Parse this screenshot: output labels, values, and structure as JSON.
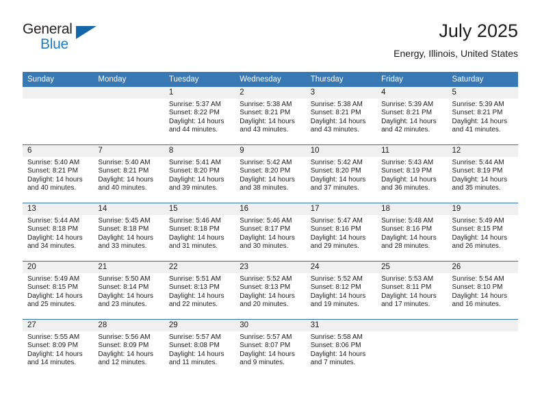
{
  "brand": {
    "name_top": "General",
    "name_bottom": "Blue",
    "triangle_color": "#1566a8",
    "blue": "#1e7bc4"
  },
  "header": {
    "title": "July 2025",
    "subtitle": "Energy, Illinois, United States"
  },
  "theme": {
    "header_bar": "#3878b4",
    "row_divider": "#2f6fad",
    "daynum_band": "#f0f0f0"
  },
  "weekday_headers": [
    "Sunday",
    "Monday",
    "Tuesday",
    "Wednesday",
    "Thursday",
    "Friday",
    "Saturday"
  ],
  "weeks": [
    [
      {
        "day": "",
        "sunrise": "",
        "sunset": "",
        "daylight1": "",
        "daylight2": ""
      },
      {
        "day": "",
        "sunrise": "",
        "sunset": "",
        "daylight1": "",
        "daylight2": ""
      },
      {
        "day": "1",
        "sunrise": "Sunrise: 5:37 AM",
        "sunset": "Sunset: 8:22 PM",
        "daylight1": "Daylight: 14 hours",
        "daylight2": "and 44 minutes."
      },
      {
        "day": "2",
        "sunrise": "Sunrise: 5:38 AM",
        "sunset": "Sunset: 8:21 PM",
        "daylight1": "Daylight: 14 hours",
        "daylight2": "and 43 minutes."
      },
      {
        "day": "3",
        "sunrise": "Sunrise: 5:38 AM",
        "sunset": "Sunset: 8:21 PM",
        "daylight1": "Daylight: 14 hours",
        "daylight2": "and 43 minutes."
      },
      {
        "day": "4",
        "sunrise": "Sunrise: 5:39 AM",
        "sunset": "Sunset: 8:21 PM",
        "daylight1": "Daylight: 14 hours",
        "daylight2": "and 42 minutes."
      },
      {
        "day": "5",
        "sunrise": "Sunrise: 5:39 AM",
        "sunset": "Sunset: 8:21 PM",
        "daylight1": "Daylight: 14 hours",
        "daylight2": "and 41 minutes."
      }
    ],
    [
      {
        "day": "6",
        "sunrise": "Sunrise: 5:40 AM",
        "sunset": "Sunset: 8:21 PM",
        "daylight1": "Daylight: 14 hours",
        "daylight2": "and 40 minutes."
      },
      {
        "day": "7",
        "sunrise": "Sunrise: 5:40 AM",
        "sunset": "Sunset: 8:21 PM",
        "daylight1": "Daylight: 14 hours",
        "daylight2": "and 40 minutes."
      },
      {
        "day": "8",
        "sunrise": "Sunrise: 5:41 AM",
        "sunset": "Sunset: 8:20 PM",
        "daylight1": "Daylight: 14 hours",
        "daylight2": "and 39 minutes."
      },
      {
        "day": "9",
        "sunrise": "Sunrise: 5:42 AM",
        "sunset": "Sunset: 8:20 PM",
        "daylight1": "Daylight: 14 hours",
        "daylight2": "and 38 minutes."
      },
      {
        "day": "10",
        "sunrise": "Sunrise: 5:42 AM",
        "sunset": "Sunset: 8:20 PM",
        "daylight1": "Daylight: 14 hours",
        "daylight2": "and 37 minutes."
      },
      {
        "day": "11",
        "sunrise": "Sunrise: 5:43 AM",
        "sunset": "Sunset: 8:19 PM",
        "daylight1": "Daylight: 14 hours",
        "daylight2": "and 36 minutes."
      },
      {
        "day": "12",
        "sunrise": "Sunrise: 5:44 AM",
        "sunset": "Sunset: 8:19 PM",
        "daylight1": "Daylight: 14 hours",
        "daylight2": "and 35 minutes."
      }
    ],
    [
      {
        "day": "13",
        "sunrise": "Sunrise: 5:44 AM",
        "sunset": "Sunset: 8:18 PM",
        "daylight1": "Daylight: 14 hours",
        "daylight2": "and 34 minutes."
      },
      {
        "day": "14",
        "sunrise": "Sunrise: 5:45 AM",
        "sunset": "Sunset: 8:18 PM",
        "daylight1": "Daylight: 14 hours",
        "daylight2": "and 33 minutes."
      },
      {
        "day": "15",
        "sunrise": "Sunrise: 5:46 AM",
        "sunset": "Sunset: 8:18 PM",
        "daylight1": "Daylight: 14 hours",
        "daylight2": "and 31 minutes."
      },
      {
        "day": "16",
        "sunrise": "Sunrise: 5:46 AM",
        "sunset": "Sunset: 8:17 PM",
        "daylight1": "Daylight: 14 hours",
        "daylight2": "and 30 minutes."
      },
      {
        "day": "17",
        "sunrise": "Sunrise: 5:47 AM",
        "sunset": "Sunset: 8:16 PM",
        "daylight1": "Daylight: 14 hours",
        "daylight2": "and 29 minutes."
      },
      {
        "day": "18",
        "sunrise": "Sunrise: 5:48 AM",
        "sunset": "Sunset: 8:16 PM",
        "daylight1": "Daylight: 14 hours",
        "daylight2": "and 28 minutes."
      },
      {
        "day": "19",
        "sunrise": "Sunrise: 5:49 AM",
        "sunset": "Sunset: 8:15 PM",
        "daylight1": "Daylight: 14 hours",
        "daylight2": "and 26 minutes."
      }
    ],
    [
      {
        "day": "20",
        "sunrise": "Sunrise: 5:49 AM",
        "sunset": "Sunset: 8:15 PM",
        "daylight1": "Daylight: 14 hours",
        "daylight2": "and 25 minutes."
      },
      {
        "day": "21",
        "sunrise": "Sunrise: 5:50 AM",
        "sunset": "Sunset: 8:14 PM",
        "daylight1": "Daylight: 14 hours",
        "daylight2": "and 23 minutes."
      },
      {
        "day": "22",
        "sunrise": "Sunrise: 5:51 AM",
        "sunset": "Sunset: 8:13 PM",
        "daylight1": "Daylight: 14 hours",
        "daylight2": "and 22 minutes."
      },
      {
        "day": "23",
        "sunrise": "Sunrise: 5:52 AM",
        "sunset": "Sunset: 8:13 PM",
        "daylight1": "Daylight: 14 hours",
        "daylight2": "and 20 minutes."
      },
      {
        "day": "24",
        "sunrise": "Sunrise: 5:52 AM",
        "sunset": "Sunset: 8:12 PM",
        "daylight1": "Daylight: 14 hours",
        "daylight2": "and 19 minutes."
      },
      {
        "day": "25",
        "sunrise": "Sunrise: 5:53 AM",
        "sunset": "Sunset: 8:11 PM",
        "daylight1": "Daylight: 14 hours",
        "daylight2": "and 17 minutes."
      },
      {
        "day": "26",
        "sunrise": "Sunrise: 5:54 AM",
        "sunset": "Sunset: 8:10 PM",
        "daylight1": "Daylight: 14 hours",
        "daylight2": "and 16 minutes."
      }
    ],
    [
      {
        "day": "27",
        "sunrise": "Sunrise: 5:55 AM",
        "sunset": "Sunset: 8:09 PM",
        "daylight1": "Daylight: 14 hours",
        "daylight2": "and 14 minutes."
      },
      {
        "day": "28",
        "sunrise": "Sunrise: 5:56 AM",
        "sunset": "Sunset: 8:09 PM",
        "daylight1": "Daylight: 14 hours",
        "daylight2": "and 12 minutes."
      },
      {
        "day": "29",
        "sunrise": "Sunrise: 5:57 AM",
        "sunset": "Sunset: 8:08 PM",
        "daylight1": "Daylight: 14 hours",
        "daylight2": "and 11 minutes."
      },
      {
        "day": "30",
        "sunrise": "Sunrise: 5:57 AM",
        "sunset": "Sunset: 8:07 PM",
        "daylight1": "Daylight: 14 hours",
        "daylight2": "and 9 minutes."
      },
      {
        "day": "31",
        "sunrise": "Sunrise: 5:58 AM",
        "sunset": "Sunset: 8:06 PM",
        "daylight1": "Daylight: 14 hours",
        "daylight2": "and 7 minutes."
      },
      {
        "day": "",
        "sunrise": "",
        "sunset": "",
        "daylight1": "",
        "daylight2": ""
      },
      {
        "day": "",
        "sunrise": "",
        "sunset": "",
        "daylight1": "",
        "daylight2": ""
      }
    ]
  ]
}
